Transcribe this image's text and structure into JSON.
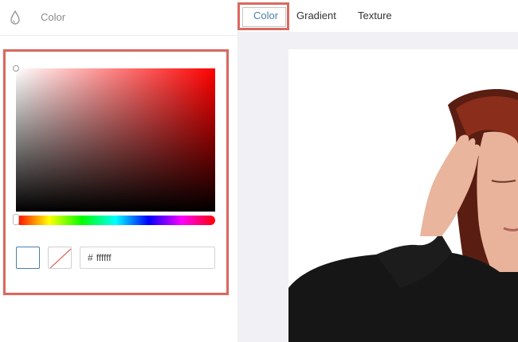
{
  "sidebar": {
    "title": "Color",
    "icon": "drop-icon"
  },
  "tabs": [
    {
      "label": "Color",
      "active": true
    },
    {
      "label": "Gradient",
      "active": false
    },
    {
      "label": "Texture",
      "active": false
    }
  ],
  "picker": {
    "hue_color": "#ff0000",
    "hex_prefix": "#",
    "hex_value": "ffffff",
    "current_swatch_color": "#ffffff",
    "highlight_color": "#d9695e"
  },
  "canvas": {
    "background": "#ffffff",
    "image": "woman-portrait"
  }
}
